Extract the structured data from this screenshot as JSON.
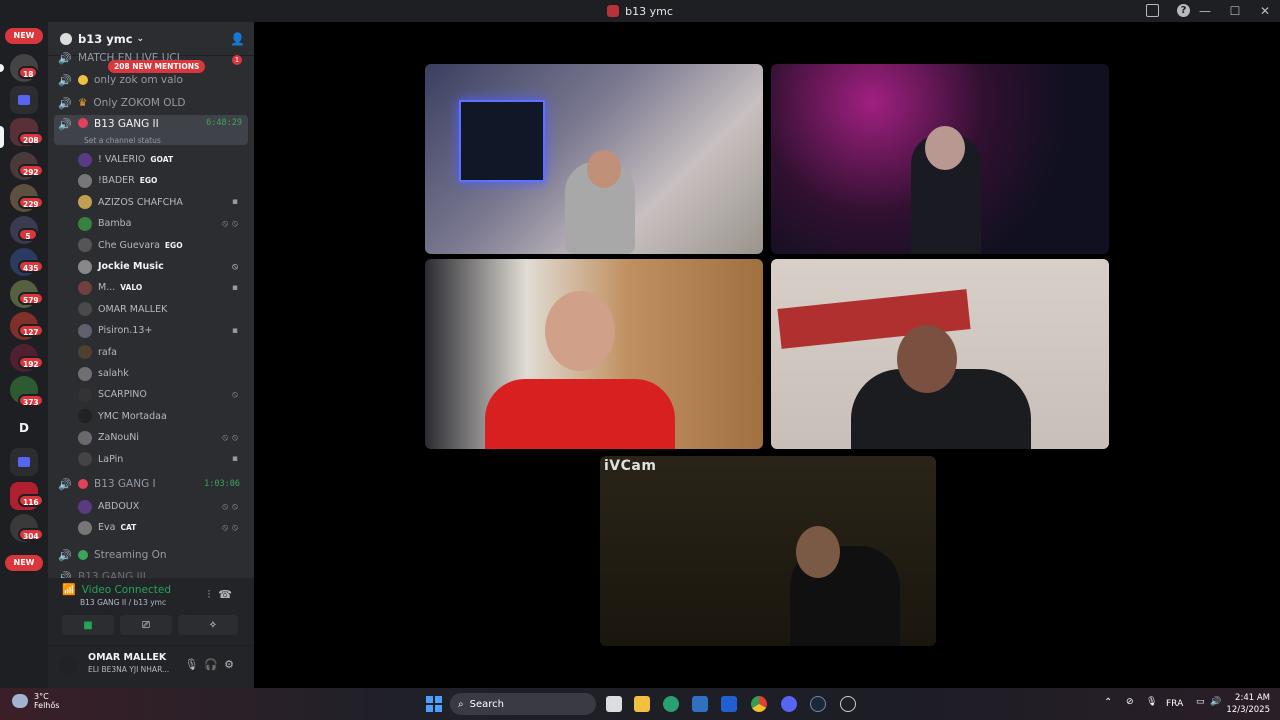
{
  "window": {
    "title": "b13 ymc"
  },
  "servers": {
    "top_new": "NEW",
    "bottom_new": "NEW",
    "dm_letter": "D",
    "badges": [
      "18",
      "208",
      "292",
      "229",
      "5",
      "435",
      "579",
      "127",
      "192",
      "373",
      "116",
      "304"
    ]
  },
  "guild": {
    "name": "b13 ymc",
    "mentions_pill": "208 NEW MENTIONS",
    "mention_count": "1"
  },
  "channels": {
    "match": "MATCH EN LIVE UCL",
    "ch1": "only zok om valo",
    "ch2": "Only ZOKOM OLD",
    "gang2": "B13 GANG II",
    "gang2_timer": "6:48:29",
    "gang2_status": "Set a channel status",
    "gang1": "B13 GANG I",
    "gang1_timer": "1:03:06",
    "streaming": "Streaming On",
    "cutoff": "B13 GANG III"
  },
  "gang2_users": [
    {
      "name": "! VALERIO",
      "tag": "GOAT"
    },
    {
      "name": "!BADER",
      "tag": "EGO"
    },
    {
      "name": "AZIZOS CHAFCHA",
      "tag": ""
    },
    {
      "name": "Bamba",
      "tag": ""
    },
    {
      "name": "Che Guevara",
      "tag": "EGO"
    },
    {
      "name": "Jockie Music",
      "tag": ""
    },
    {
      "name": "M...",
      "tag": "VALO"
    },
    {
      "name": "OMAR MALLEK",
      "tag": ""
    },
    {
      "name": "Pisiron.13+",
      "tag": ""
    },
    {
      "name": "rafa",
      "tag": ""
    },
    {
      "name": "salahk",
      "tag": ""
    },
    {
      "name": "SCARPINO",
      "tag": ""
    },
    {
      "name": "YMC Mortadaa",
      "tag": ""
    },
    {
      "name": "ZaNouNi",
      "tag": ""
    },
    {
      "name": "LaPin",
      "tag": ""
    }
  ],
  "gang1_users": [
    {
      "name": "ABDOUX",
      "tag": ""
    },
    {
      "name": "Eva",
      "tag": "CAT"
    }
  ],
  "voice_panel": {
    "status": "Video Connected",
    "location": "B13 GANG II / b13 ymc"
  },
  "user_panel": {
    "name": "OMAR MALLEK",
    "status": "ELI BE3NA YJI NHAR..."
  },
  "stage": {
    "watermark": "iVCam"
  },
  "taskbar": {
    "temp": "3°C",
    "weather_desc": "Felhős",
    "search_placeholder": "Search",
    "lang": "FRA",
    "time": "2:41 AM",
    "date": "12/3/2025"
  }
}
